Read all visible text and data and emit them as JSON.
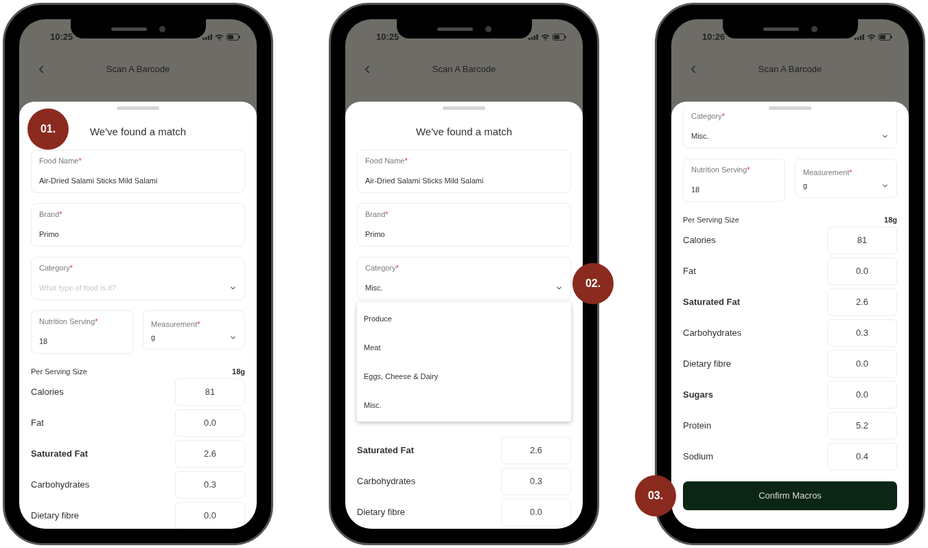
{
  "phones": [
    {
      "status_time": "10:25",
      "header": {
        "title": "Scan A Barcode"
      },
      "badge": "01.",
      "sheet": {
        "title": "We've found a match",
        "scrolled": false,
        "form_rows": [
          [
            {
              "kind": "text",
              "label": "Food Name",
              "required_mark": "*",
              "value": "Air-Dried Salami Sticks Mild Salami"
            }
          ],
          [
            {
              "kind": "text",
              "label": "Brand",
              "required_mark": "*",
              "value": "Primo"
            }
          ],
          [
            {
              "kind": "select",
              "label": "Category",
              "required_mark": "*",
              "placeholder": "What type of food is it?"
            }
          ],
          [
            {
              "kind": "text",
              "label": "Nutrition Serving",
              "required_mark": "*",
              "value": "18"
            },
            {
              "kind": "select",
              "label": "Measurement",
              "required_mark": "*",
              "value": "g"
            }
          ]
        ],
        "serving": {
          "label": "Per Serving Size",
          "value": "18g"
        },
        "nutrients": [
          {
            "label": "Calories",
            "value": "81",
            "bold": false
          },
          {
            "label": "Fat",
            "value": "0.0",
            "bold": false
          },
          {
            "label": "Saturated Fat",
            "value": "2.6",
            "bold": true
          },
          {
            "label": "Carbohydrates",
            "value": "0.3",
            "bold": false
          },
          {
            "label": "Dietary fibre",
            "value": "0.0",
            "bold": false
          }
        ]
      }
    },
    {
      "status_time": "10:25",
      "header": {
        "title": "Scan A Barcode"
      },
      "badge": "02.",
      "sheet": {
        "title": "We've found a match",
        "scrolled": false,
        "form_rows": [
          [
            {
              "kind": "text",
              "label": "Food Name",
              "required_mark": "*",
              "value": "Air-Dried Salami Sticks Mild Salami"
            }
          ],
          [
            {
              "kind": "text",
              "label": "Brand",
              "required_mark": "*",
              "value": "Primo"
            }
          ],
          [
            {
              "kind": "select",
              "label": "Category",
              "required_mark": "*",
              "value": "Misc.",
              "menu": [
                "Produce",
                "Meat",
                "Eggs, Cheese & Dairy",
                "Misc."
              ]
            }
          ]
        ],
        "nutrients": [
          {
            "label": "Saturated Fat",
            "value": "2.6",
            "bold": true
          },
          {
            "label": "Carbohydrates",
            "value": "0.3",
            "bold": false
          },
          {
            "label": "Dietary fibre",
            "value": "0.0",
            "bold": false
          }
        ]
      }
    },
    {
      "status_time": "10:26",
      "header": {
        "title": "Scan A Barcode"
      },
      "badge": "03.",
      "sheet": {
        "scrolled": true,
        "form_rows": [
          [
            {
              "kind": "select",
              "label": "Category",
              "required_mark": "*",
              "value": "Misc."
            }
          ],
          [
            {
              "kind": "text",
              "label": "Nutrition Serving",
              "required_mark": "*",
              "value": "18"
            },
            {
              "kind": "select",
              "label": "Measurement",
              "required_mark": "*",
              "value": "g"
            }
          ]
        ],
        "serving": {
          "label": "Per Serving Size",
          "value": "18g"
        },
        "nutrients": [
          {
            "label": "Calories",
            "value": "81",
            "bold": false
          },
          {
            "label": "Fat",
            "value": "0.0",
            "bold": false
          },
          {
            "label": "Saturated Fat",
            "value": "2.6",
            "bold": true
          },
          {
            "label": "Carbohydrates",
            "value": "0.3",
            "bold": false
          },
          {
            "label": "Dietary fibre",
            "value": "0.0",
            "bold": false
          },
          {
            "label": "Sugars",
            "value": "0.0",
            "bold": true
          },
          {
            "label": "Protein",
            "value": "5.2",
            "bold": false
          },
          {
            "label": "Sodium",
            "value": "0.4",
            "bold": false
          }
        ],
        "button": "Confirm Macros"
      }
    }
  ]
}
